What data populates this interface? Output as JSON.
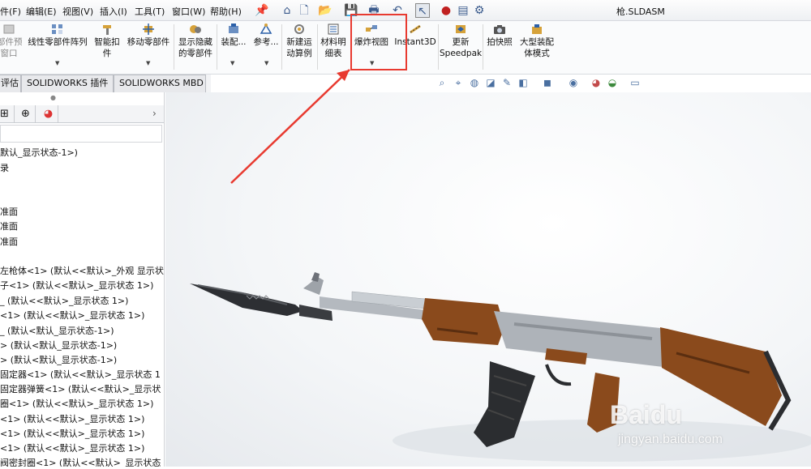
{
  "window": {
    "title": "枪.SLDASM"
  },
  "menu": {
    "items": [
      "件(F)",
      "编辑(E)",
      "视图(V)",
      "插入(I)",
      "工具(T)",
      "窗口(W)",
      "帮助(H)"
    ]
  },
  "ribbon": {
    "buttons": [
      {
        "id": "preview",
        "label": "部件预\n窗口"
      },
      {
        "id": "linear-pattern",
        "label": "线性零部件阵列"
      },
      {
        "id": "smart-fastener",
        "label": "智能扣\n件"
      },
      {
        "id": "move-component",
        "label": "移动零部件"
      },
      {
        "id": "show-hidden",
        "label": "显示隐藏\n的零部件"
      },
      {
        "id": "assembly",
        "label": "装配..."
      },
      {
        "id": "reference",
        "label": "参考..."
      },
      {
        "id": "new-motion-study",
        "label": "新建运\n动算例"
      },
      {
        "id": "bom",
        "label": "材料明\n细表"
      },
      {
        "id": "exploded-view",
        "label": "爆炸视图"
      },
      {
        "id": "instant3d",
        "label": "Instant3D"
      },
      {
        "id": "update-speedpak",
        "label": "更新\nSpeedpak"
      },
      {
        "id": "snapshot",
        "label": "拍快照"
      },
      {
        "id": "large-assembly",
        "label": "大型装配\n体模式"
      }
    ]
  },
  "tabs": [
    "评估",
    "SOLIDWORKS 插件",
    "SOLIDWORKS MBD"
  ],
  "tree": {
    "lines": [
      "默认_显示状态-1>)",
      "录",
      "准面",
      "准面",
      "准面",
      "左枪体<1> (默认<<默认>_外观 显示状",
      "子<1> (默认<<默认>_显示状态 1>)",
      "_ (默认<<默认>_显示状态 1>)",
      "<1> (默认<<默认>_显示状态 1>)",
      "_ (默认<默认_显示状态-1>)",
      "> (默认<默认_显示状态-1>)",
      "> (默认<默认_显示状态-1>)",
      "固定器<1> (默认<<默认>_显示状态 1",
      "固定器弹簧<1> (默认<<默认>_显示状",
      "圈<1> (默认<<默认>_显示状态 1>)",
      "<1> (默认<<默认>_显示状态 1>)",
      "<1> (默认<<默认>_显示状态 1>)",
      "<1> (默认<<默认>_显示状态 1>)",
      "阀密封圈<1> (默认<<默认>_显示状态"
    ]
  },
  "watermark": {
    "text": "Baidu",
    "sub": "jingyan.baidu.com"
  },
  "colors": {
    "highlight": "#e83a30",
    "wood": "#8a4a1c",
    "metal": "#b9bec4",
    "dark_metal": "#2b2d30"
  }
}
